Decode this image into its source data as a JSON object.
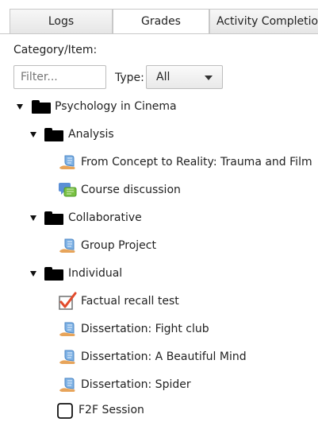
{
  "tabs": [
    {
      "label": "Logs"
    },
    {
      "label": "Grades"
    },
    {
      "label": "Activity Completio"
    }
  ],
  "category_label": "Category/Item:",
  "filter": {
    "placeholder": "Filter...",
    "value": ""
  },
  "type": {
    "label": "Type:",
    "selected": "All"
  },
  "tree": {
    "root": {
      "label": "Psychology in Cinema",
      "icon": "folder-icon"
    },
    "analysis": {
      "label": "Analysis",
      "icon": "folder-icon"
    },
    "trauma_film": {
      "label": "From Concept to Reality: Trauma and Film",
      "icon": "assignment-icon"
    },
    "course_discussion": {
      "label": "Course discussion",
      "icon": "forum-icon"
    },
    "collaborative": {
      "label": "Collaborative",
      "icon": "folder-icon"
    },
    "group_project": {
      "label": "Group Project",
      "icon": "assignment-icon"
    },
    "individual": {
      "label": "Individual",
      "icon": "folder-icon"
    },
    "factual_recall": {
      "label": "Factual recall test",
      "icon": "quiz-icon"
    },
    "fight_club": {
      "label": "Dissertation: Fight club",
      "icon": "assignment-icon"
    },
    "beautiful_mind": {
      "label": "Dissertation: A Beautiful Mind",
      "icon": "assignment-icon"
    },
    "spider": {
      "label": "Dissertation: Spider",
      "icon": "assignment-icon"
    },
    "f2f": {
      "label": "F2F Session",
      "icon": "attendance-icon"
    }
  }
}
